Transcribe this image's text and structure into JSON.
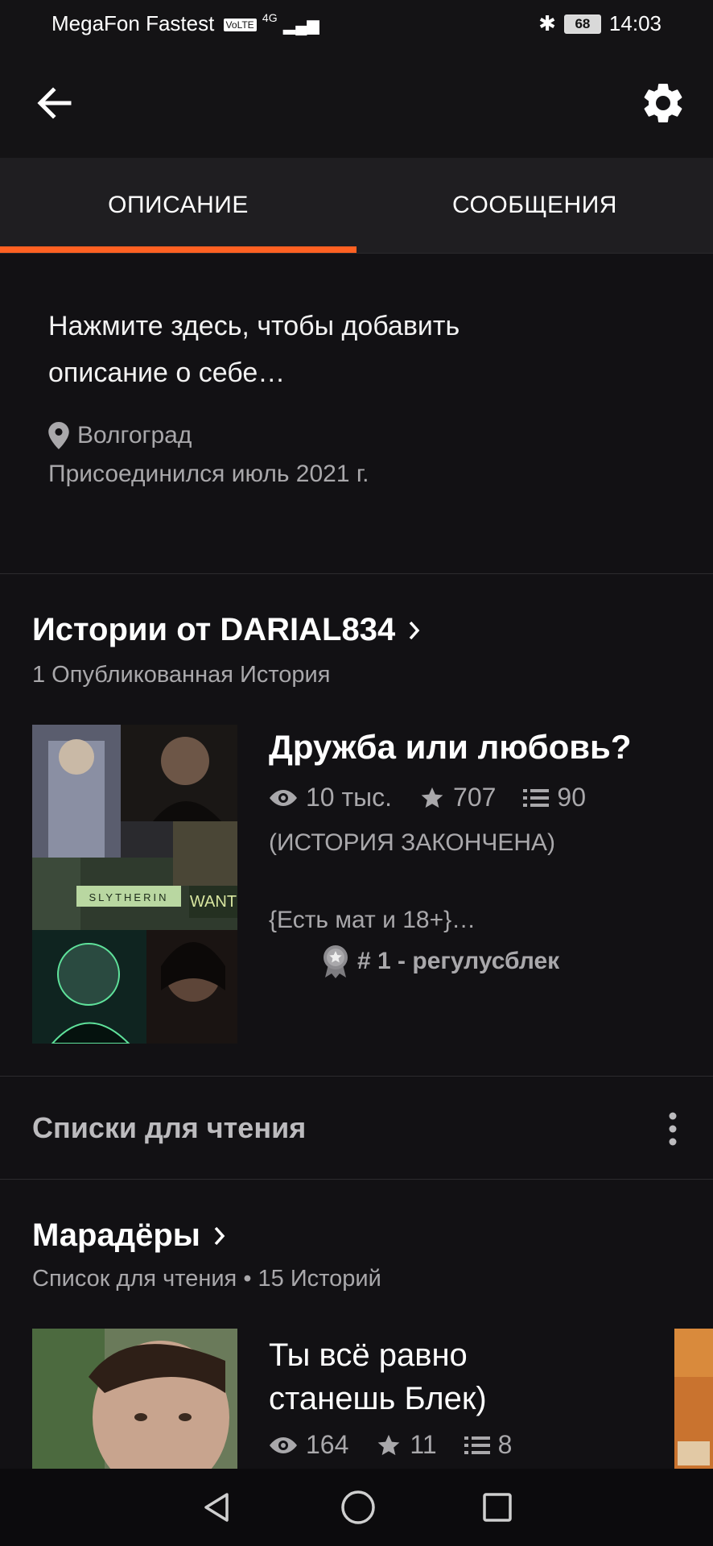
{
  "status_bar": {
    "carrier": "MegaFon Fastest",
    "volte_badge": "VoLTE",
    "network": "4G",
    "battery": "68",
    "time": "14:03"
  },
  "tabs": [
    {
      "label": "ОПИСАНИЕ",
      "active": true
    },
    {
      "label": "СООБЩЕНИЯ",
      "active": false
    }
  ],
  "about": {
    "description_line1": "Нажмите здесь, чтобы добавить",
    "description_line2": "описание о себе…",
    "location": "Волгоград",
    "joined": "Присоединился июль 2021 г."
  },
  "stories_section": {
    "title": "Истории от DARIAL834",
    "subtitle": "1 Опубликованная История",
    "story": {
      "title": "Дружба или любовь?",
      "reads": "10 тыс.",
      "votes": "707",
      "parts": "90",
      "status": "(ИСТОРИЯ ЗАКОНЧЕНА)",
      "tagline": "{Есть мат и 18+}…",
      "rank": "# 1 - регулусблек",
      "cover_text": "SLYTHERIN",
      "cover_text2": "WANT"
    }
  },
  "reading_lists": {
    "header": "Списки для чтения",
    "list": {
      "title": "Марадёры",
      "subtitle": "Список для чтения • 15 Историй",
      "story": {
        "title_line1": "Ты всё равно",
        "title_line2": "станешь Блек)",
        "reads": "164",
        "votes": "11",
        "parts": "8"
      }
    }
  },
  "colors": {
    "accent": "#ff6122",
    "background": "#121114",
    "muted_text": "#a9a8ab"
  }
}
